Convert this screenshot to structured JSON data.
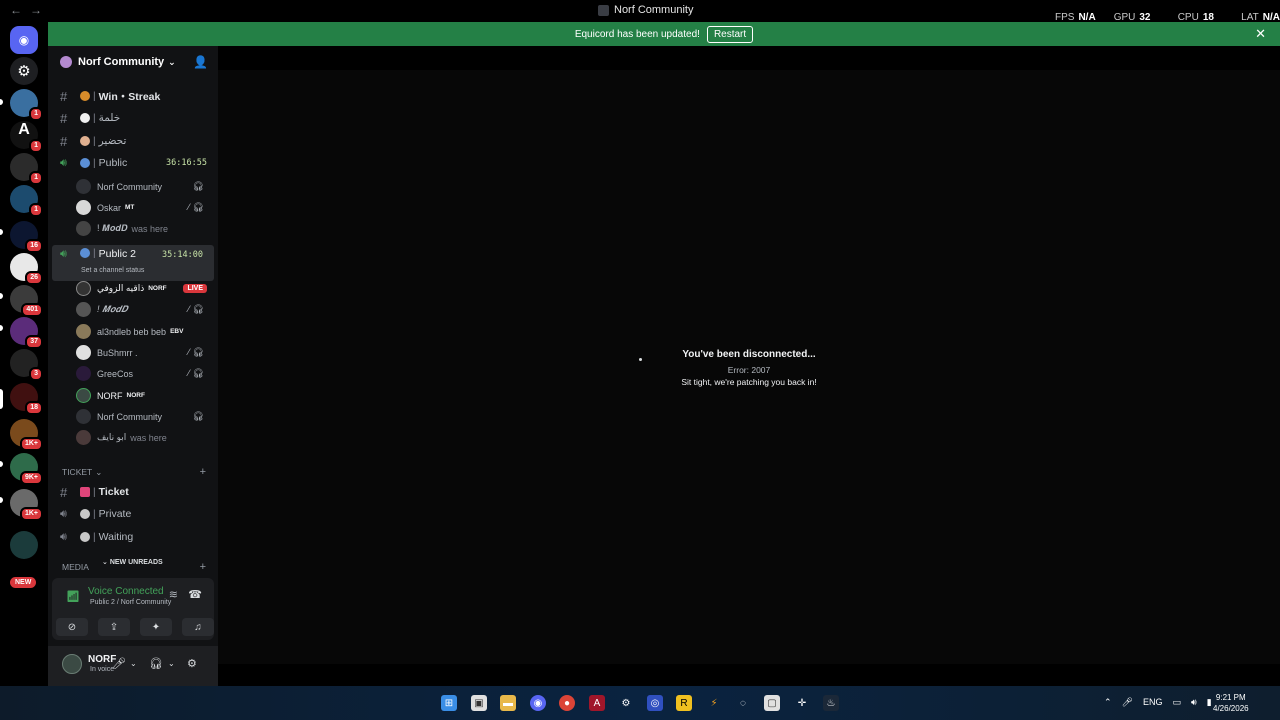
{
  "window": {
    "title": "Norf Community",
    "perf": [
      {
        "label": "FPS",
        "value": "N/A"
      },
      {
        "label": "GPU",
        "value": "32 %"
      },
      {
        "label": "CPU",
        "value": "18 %"
      },
      {
        "label": "LAT",
        "value": "N/A"
      }
    ]
  },
  "banner": {
    "text": "Equicord has been updated!",
    "button": "Restart"
  },
  "rail": {
    "badges": [
      "1",
      "1",
      "1",
      "1",
      "16",
      "26",
      "401",
      "37",
      "3",
      "18",
      "1K+",
      "9K+",
      "1K+"
    ],
    "new_label": "NEW"
  },
  "server": {
    "name": "Norf Community"
  },
  "channels": {
    "win_streak": "Win・Streak",
    "ch2": "خلمة",
    "ch3": "تحضير",
    "public": {
      "name": "Public",
      "timer": "36:16:55"
    },
    "public_users": [
      {
        "name": "Norf Community"
      },
      {
        "name": "Oskar",
        "tag": "MT"
      },
      {
        "name": "! 𝑴𝒐𝒅𝑫",
        "suffix": "was here"
      }
    ],
    "public2": {
      "name": "Public 2",
      "timer": "35:14:00",
      "status": "Set a channel status"
    },
    "public2_users": [
      {
        "name": "ذاقيه الزوفي",
        "tag": "NORF",
        "live": "LIVE"
      },
      {
        "name": "! 𝑴𝒐𝒅𝑫"
      },
      {
        "name": "al3ndleb beb beb",
        "tag": "EBV"
      },
      {
        "name": "BuShmrr ."
      },
      {
        "name": "GreeCos"
      },
      {
        "name": "NORF",
        "tag": "NORF"
      },
      {
        "name": "Norf Community"
      },
      {
        "name": "ابو نايف",
        "suffix": "was here"
      }
    ],
    "ticket_category": "TICKET",
    "ticket": "Ticket",
    "private": "Private",
    "waiting": "Waiting",
    "media_category": "MEDIA",
    "new_unreads": "NEW UNREADS"
  },
  "voice": {
    "title": "Voice Connected",
    "subtitle": "Public 2 / Norf Community"
  },
  "user": {
    "name": "NORF",
    "status": "In voice"
  },
  "main": {
    "title": "You've been disconnected...",
    "error": "Error: 2007",
    "message": "Sit tight, we're patching you back in!"
  },
  "taskbar": {
    "lang": "ENG",
    "time": "9:21 PM",
    "date": "4/26/2026"
  }
}
